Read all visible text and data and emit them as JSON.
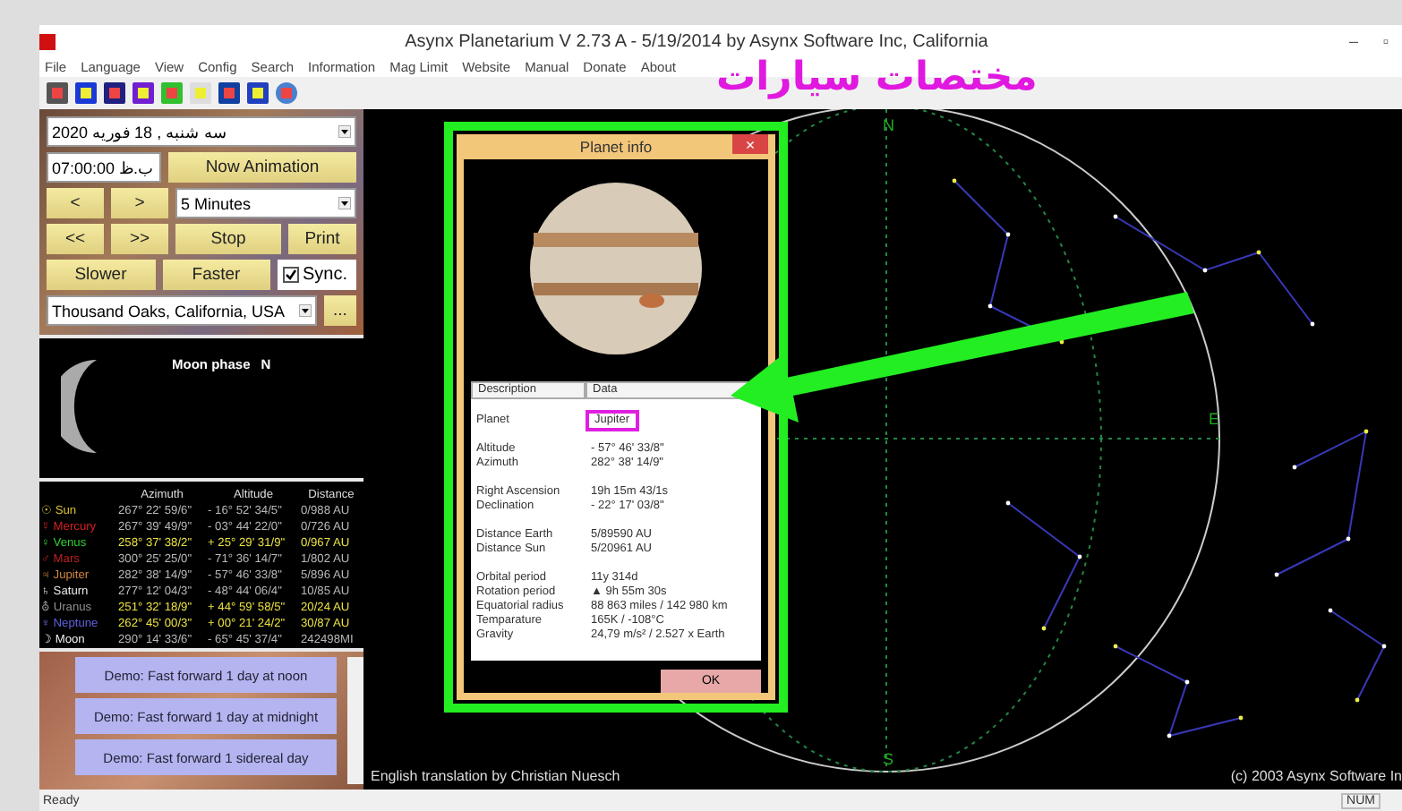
{
  "window": {
    "title": "Asynx Planetarium V 2.73 A - 5/19/2014 by Asynx Software Inc, California",
    "controls": [
      "–",
      "▫"
    ]
  },
  "menu": [
    "File",
    "Language",
    "View",
    "Config",
    "Search",
    "Information",
    "Mag Limit",
    "Website",
    "Manual",
    "Donate",
    "About"
  ],
  "annotation": {
    "text": "مختصات سیارات"
  },
  "controls": {
    "date": "سه شنبه , 18 فوریه 2020",
    "time": "07:00:00 ب.ظ",
    "now_button": "Now Animation",
    "step_back": "<",
    "step_forward": ">",
    "interval": "5 Minutes",
    "fast_back": "<<",
    "fast_forward": ">>",
    "stop": "Stop",
    "print": "Print",
    "slower": "Slower",
    "faster": "Faster",
    "sync": {
      "label": "Sync.",
      "checked": true
    },
    "location": "Thousand Oaks, California, USA",
    "location_more": "..."
  },
  "moon_phase": {
    "label": "Moon phase",
    "value": "N"
  },
  "planets": {
    "columns": [
      "Azimuth",
      "Altitude",
      "Distance"
    ],
    "rows": [
      {
        "symbol": "☉",
        "name": "Sun",
        "color": "#d8c030",
        "above_horizon": false,
        "azimuth": "267° 22' 59/6\"",
        "altitude": "- 16° 52' 34/5\"",
        "distance": "0/988 AU"
      },
      {
        "symbol": "☿",
        "name": "Mercury",
        "color": "#d82020",
        "above_horizon": false,
        "azimuth": "267° 39' 49/9\"",
        "altitude": "- 03° 44' 22/0\"",
        "distance": "0/726 AU"
      },
      {
        "symbol": "♀",
        "name": "Venus",
        "color": "#30d030",
        "above_horizon": true,
        "azimuth": "258° 37' 38/2\"",
        "altitude": "+ 25° 29' 31/9\"",
        "distance": "0/967 AU"
      },
      {
        "symbol": "♂",
        "name": "Mars",
        "color": "#c02020",
        "above_horizon": false,
        "azimuth": "300° 25' 25/0\"",
        "altitude": "- 71° 36' 14/7\"",
        "distance": "1/802 AU"
      },
      {
        "symbol": "♃",
        "name": "Jupiter",
        "color": "#d08840",
        "above_horizon": false,
        "azimuth": "282° 38' 14/9\"",
        "altitude": "- 57° 46' 33/8\"",
        "distance": "5/896 AU"
      },
      {
        "symbol": "♄",
        "name": "Saturn",
        "color": "#e8e8e8",
        "above_horizon": false,
        "azimuth": "277° 12' 04/3\"",
        "altitude": "- 48° 44' 06/4\"",
        "distance": "10/85 AU"
      },
      {
        "symbol": "⛢",
        "name": "Uranus",
        "color": "#909090",
        "above_horizon": true,
        "azimuth": "251° 32' 18/9\"",
        "altitude": "+ 44° 59' 58/5\"",
        "distance": "20/24 AU"
      },
      {
        "symbol": "♆",
        "name": "Neptune",
        "color": "#6060e0",
        "above_horizon": true,
        "azimuth": "262° 45' 00/3\"",
        "altitude": "+ 00° 21' 24/2\"",
        "distance": "30/87 AU"
      },
      {
        "symbol": "☽",
        "name": "Moon",
        "color": "#f0f0f0",
        "above_horizon": false,
        "azimuth": "290° 14' 33/6\"",
        "altitude": "- 65° 45' 37/4\"",
        "distance": "242498MI"
      }
    ]
  },
  "demos": [
    "Demo: Fast forward 1 day at noon",
    "Demo: Fast forward 1 day at midnight",
    "Demo: Fast forward 1 sidereal day"
  ],
  "sky": {
    "compass": [
      "N",
      "E",
      "S"
    ],
    "credit": "English translation by Christian Nuesch",
    "copyright": "(c) 2003 Asynx Software In"
  },
  "planet_info": {
    "title": "Planet info",
    "close": "×",
    "columns": [
      "Description",
      "Data"
    ],
    "groups": [
      [
        {
          "label": "Planet",
          "value": "Jupiter",
          "highlighted": true
        }
      ],
      [
        {
          "label": "Altitude",
          "value": "- 57° 46' 33/8\"",
          "highlighted": false
        },
        {
          "label": "Azimuth",
          "value": "282° 38' 14/9\"",
          "highlighted": false
        }
      ],
      [
        {
          "label": "Right Ascension",
          "value": "19h 15m 43/1s",
          "highlighted": false
        },
        {
          "label": "Declination",
          "value": "- 22° 17' 03/8\"",
          "highlighted": false
        }
      ],
      [
        {
          "label": "Distance Earth",
          "value": "5/89590 AU",
          "highlighted": false
        },
        {
          "label": "Distance Sun",
          "value": "5/20961 AU",
          "highlighted": false
        }
      ],
      [
        {
          "label": "Orbital period",
          "value": "11y 314d",
          "highlighted": false
        },
        {
          "label": "Rotation period",
          "value": "▲ 9h 55m 30s",
          "highlighted": false
        },
        {
          "label": "Equatorial radius",
          "value": "88 863 miles / 142 980 km",
          "highlighted": false
        },
        {
          "label": "Temparature",
          "value": "165K / -108°C",
          "highlighted": false
        },
        {
          "label": "Gravity",
          "value": "24,79 m/s² / 2.527 x Earth",
          "highlighted": false
        }
      ]
    ],
    "ok": "OK"
  },
  "status_bar": {
    "text": "Ready",
    "indicator": "NUM"
  }
}
